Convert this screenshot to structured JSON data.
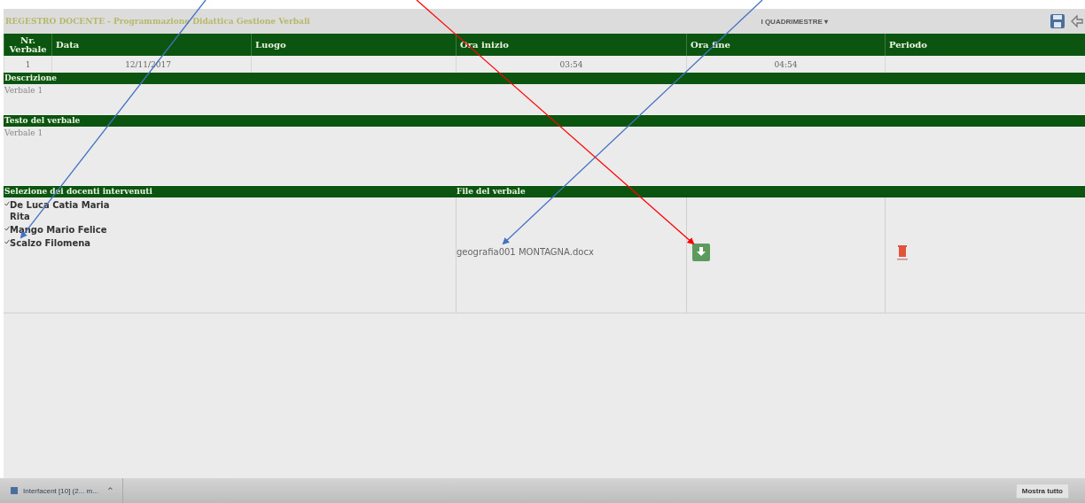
{
  "header": {
    "title": "REGESTRO DOCENTE - Programmazione Didattica Gestione Verbali",
    "period_select": "I QUADRIMESTRE ▾"
  },
  "table": {
    "columns": [
      "Nr. Verbale",
      "Data",
      "Luogo",
      "Ora inizio",
      "Ora fine",
      "Periodo"
    ],
    "rows": [
      {
        "cells": [
          "1",
          "12/11/2017",
          "",
          "03:54",
          "04:54",
          ""
        ]
      }
    ]
  },
  "description": {
    "label": "Descrizione",
    "value": "Verbale 1"
  },
  "minutes_text": {
    "label": "Testo del verbale",
    "value": "Verbale 1"
  },
  "teachers": {
    "label": "Selezione dei docenti intervenuti",
    "items": [
      {
        "name": "De Luca Catia Maria Rita",
        "checked": true
      },
      {
        "name": "Mango Mario Felice",
        "checked": true
      },
      {
        "name": "Scalzo Filomena",
        "checked": true
      }
    ]
  },
  "files": {
    "label": "File del verbale",
    "items": [
      {
        "name": "geografia001 MONTAGNA.docx"
      }
    ]
  },
  "annotations": [
    {
      "color": "#4472c4"
    },
    {
      "color": "#4472c4"
    },
    {
      "color": "#ff0000"
    }
  ],
  "taskbar": {
    "item": "Interfacent [10] (2... m...",
    "caret": "^",
    "show_all": "Mostra tutto"
  }
}
